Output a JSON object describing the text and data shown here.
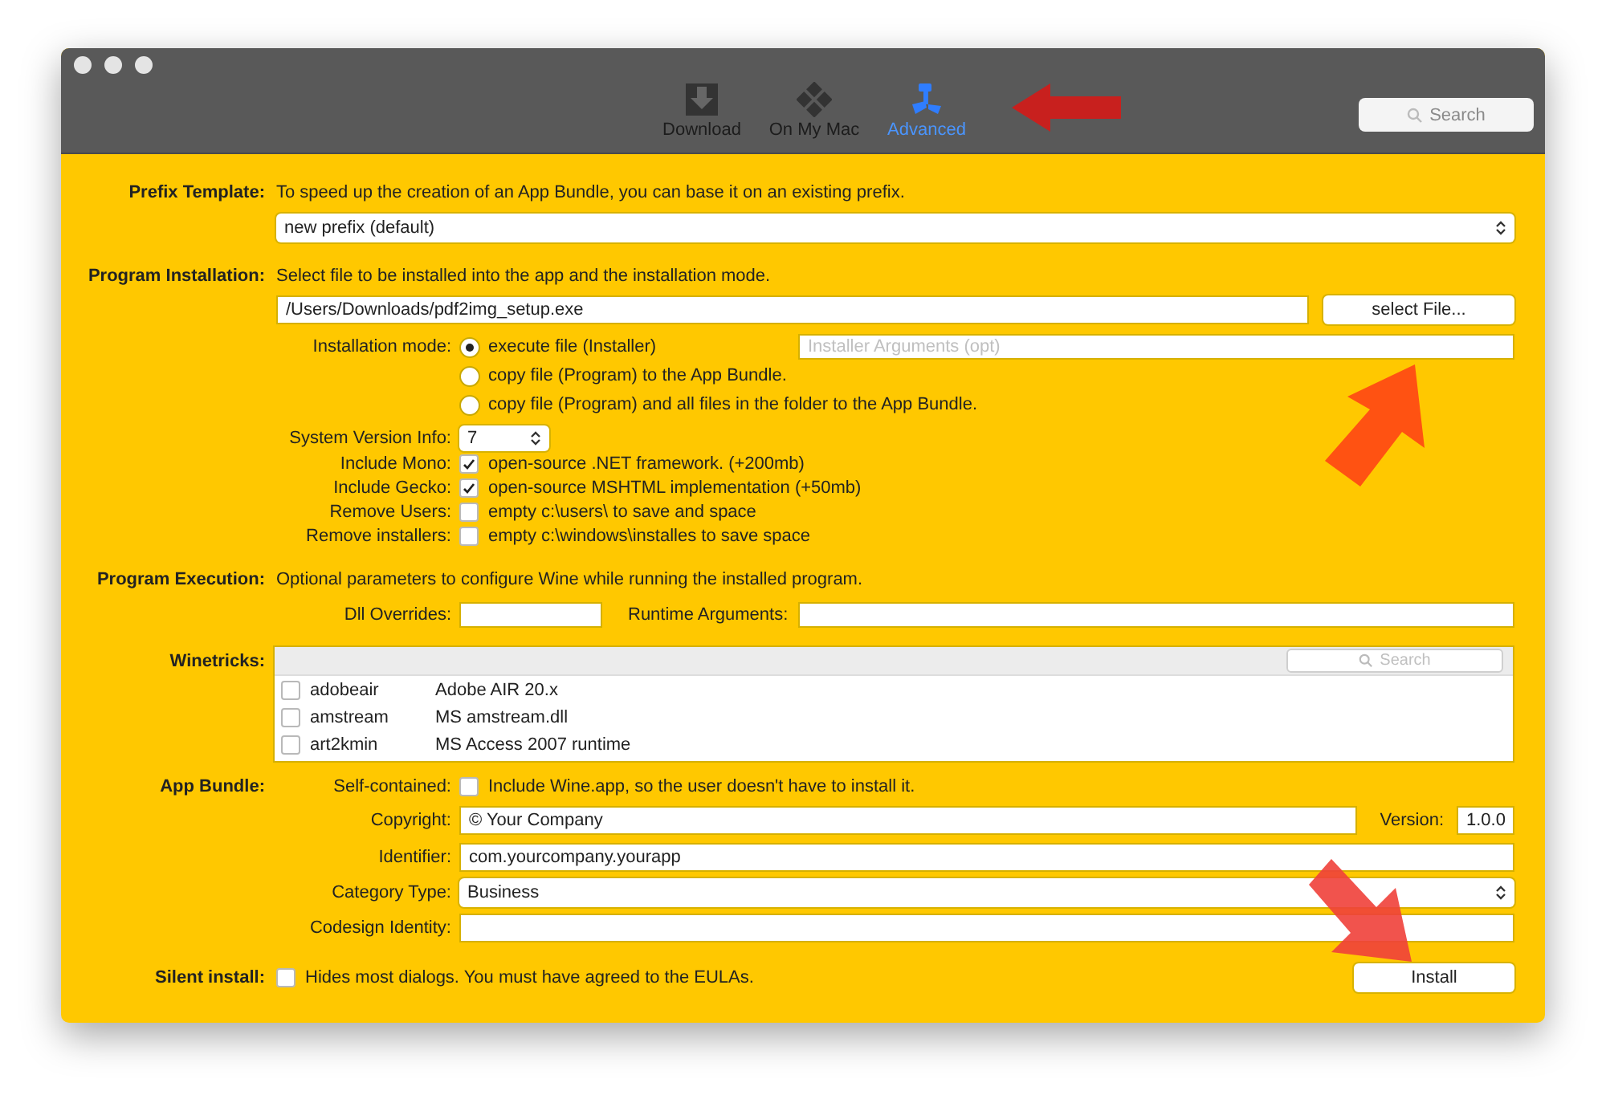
{
  "toolbar": {
    "tabs": [
      {
        "label": "Download",
        "kind": "download",
        "selected": false
      },
      {
        "label": "On My Mac",
        "kind": "mac",
        "selected": false
      },
      {
        "label": "Advanced",
        "kind": "advanced",
        "selected": true
      }
    ],
    "search": {
      "placeholder": "Search"
    }
  },
  "prefix_template": {
    "label": "Prefix Template:",
    "description": "To speed up the creation of an App Bundle, you can base it on an existing prefix.",
    "select": "new prefix (default)"
  },
  "program_installation": {
    "label": "Program Installation:",
    "description": "Select file to be installed into the app and the installation mode.",
    "file_path": "/Users/Downloads/pdf2img_setup.exe",
    "select_button": "select File...",
    "mode_label": "Installation mode:",
    "modes": [
      {
        "label": "execute file (Installer)",
        "selected": true
      },
      {
        "label": "copy file (Program)  to the App Bundle.",
        "selected": false
      },
      {
        "label": "copy file (Program)  and all files in the folder to the App Bundle.",
        "selected": false
      }
    ],
    "arguments": {
      "placeholder": "Installer Arguments (opt)"
    },
    "system_version": {
      "label": "System Version Info:",
      "value": "7"
    },
    "options": [
      {
        "label": "Include Mono:",
        "text": "open-source .NET framework. (+200mb)",
        "checked": true
      },
      {
        "label": "Include Gecko:",
        "text": "open-source MSHTML implementation (+50mb)",
        "checked": true
      },
      {
        "label": "Remove Users:",
        "text": "empty c:\\users\\ to save and space",
        "checked": false
      },
      {
        "label": "Remove installers:",
        "text": "empty c:\\windows\\installes to save space",
        "checked": false
      }
    ]
  },
  "program_execution": {
    "label": "Program Execution:",
    "description": "Optional parameters to configure Wine while running the installed program.",
    "dll_overrides": {
      "label": "Dll Overrides:"
    },
    "runtime_arguments": {
      "label": "Runtime Arguments:"
    }
  },
  "winetricks": {
    "label": "Winetricks:",
    "search": {
      "placeholder": "Search"
    },
    "items": [
      {
        "name": "adobeair",
        "description": "Adobe AIR 20.x",
        "checked": false
      },
      {
        "name": "amstream",
        "description": "MS amstream.dll",
        "checked": false
      },
      {
        "name": "art2kmin",
        "description": "MS Access 2007 runtime",
        "checked": false
      }
    ]
  },
  "app_bundle": {
    "label": "App Bundle:",
    "self_contained": {
      "label": "Self-contained:",
      "text": "Include Wine.app, so the user doesn't have to install it.",
      "checked": false
    },
    "copyright": {
      "label": "Copyright:",
      "value": "© Your Company"
    },
    "version": {
      "label": "Version:",
      "value": "1.0.0"
    },
    "identifier": {
      "label": "Identifier:",
      "value": "com.yourcompany.yourapp"
    },
    "category": {
      "label": "Category Type:",
      "value": "Business"
    },
    "codesign": {
      "label": "Codesign Identity:"
    }
  },
  "silent_install": {
    "label": "Silent install:",
    "text": "Hides most dialogs. You must have agreed to the EULAs.",
    "checked": false
  },
  "install_button": "Install"
}
